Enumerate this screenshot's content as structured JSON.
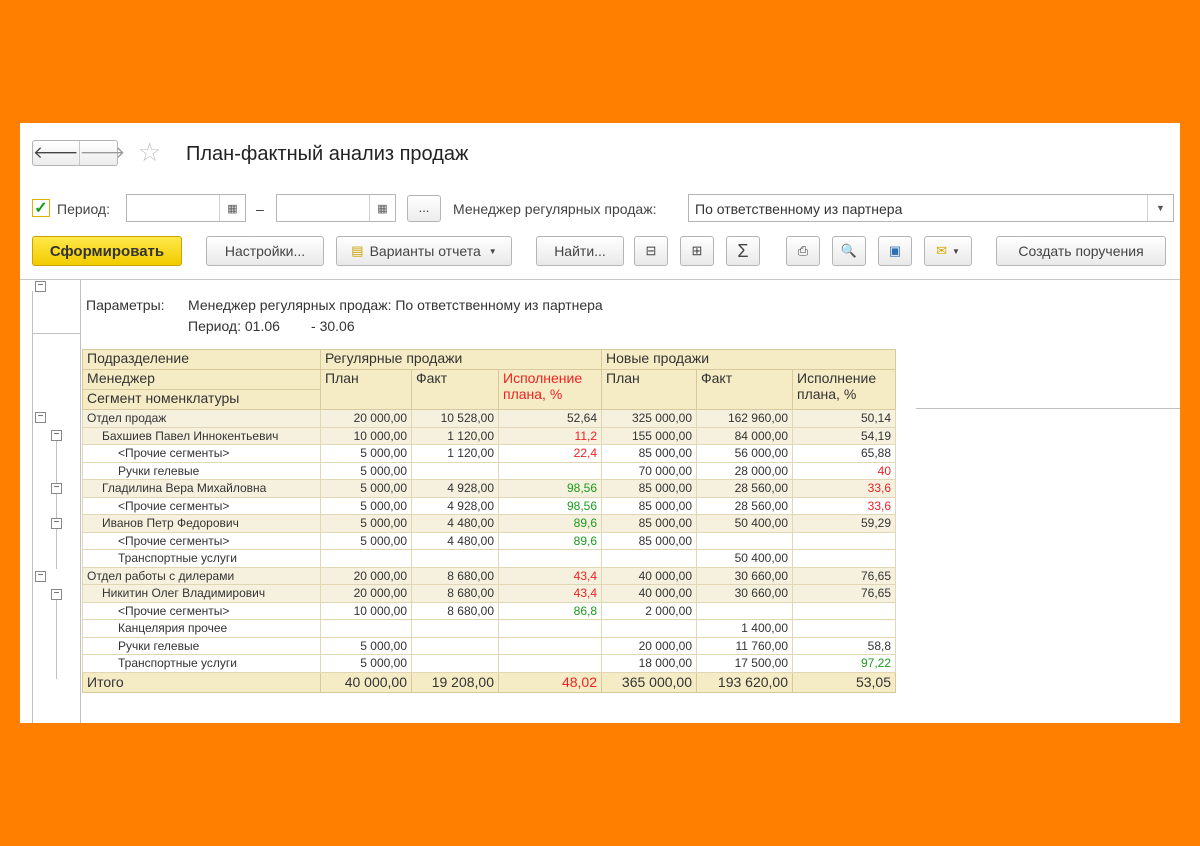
{
  "header": {
    "title": "План-фактный анализ продаж",
    "back": "🡐",
    "forward": "🡒",
    "star": "☆"
  },
  "filters": {
    "period_label": "Период:",
    "dash": "–",
    "dots": "...",
    "manager_label": "Менеджер регулярных продаж:",
    "manager_value": "По ответственному из партнера"
  },
  "toolbar": {
    "generate": "Сформировать",
    "settings": "Настройки...",
    "variants": "Варианты отчета",
    "find": "Найти...",
    "create_order": "Создать поручения"
  },
  "params": {
    "label": "Параметры:",
    "line1": "Менеджер регулярных продаж: По ответственному из партнера",
    "line2": "Период: 01.06        - 30.06"
  },
  "table": {
    "h_dept": "Подразделение",
    "h_manager": "Менеджер",
    "h_segment": "Сегмент номенклатуры",
    "h_regular": "Регулярные продажи",
    "h_new": "Новые продажи",
    "h_plan": "План",
    "h_fact": "Факт",
    "h_exec_1": "Исполнение",
    "h_exec_2": "плана, %",
    "rows": [
      {
        "name": "Отдел продаж",
        "p1": "20 000,00",
        "f1": "10 528,00",
        "e1": "52,64",
        "p2": "325 000,00",
        "f2": "162 960,00",
        "e2": "50,14"
      },
      {
        "name": "Бахшиев Павел Иннокентьевич",
        "p1": "10 000,00",
        "f1": "1 120,00",
        "e1": "11,2",
        "p2": "155 000,00",
        "f2": "84 000,00",
        "e2": "54,19"
      },
      {
        "name": "<Прочие сегменты>",
        "p1": "5 000,00",
        "f1": "1 120,00",
        "e1": "22,4",
        "p2": "85 000,00",
        "f2": "56 000,00",
        "e2": "65,88"
      },
      {
        "name": "Ручки гелевые",
        "p1": "5 000,00",
        "f1": "",
        "e1": "",
        "p2": "70 000,00",
        "f2": "28 000,00",
        "e2": "40"
      },
      {
        "name": "Гладилина Вера Михайловна",
        "p1": "5 000,00",
        "f1": "4 928,00",
        "e1": "98,56",
        "p2": "85 000,00",
        "f2": "28 560,00",
        "e2": "33,6"
      },
      {
        "name": "<Прочие сегменты>",
        "p1": "5 000,00",
        "f1": "4 928,00",
        "e1": "98,56",
        "p2": "85 000,00",
        "f2": "28 560,00",
        "e2": "33,6"
      },
      {
        "name": "Иванов Петр Федорович",
        "p1": "5 000,00",
        "f1": "4 480,00",
        "e1": "89,6",
        "p2": "85 000,00",
        "f2": "50 400,00",
        "e2": "59,29"
      },
      {
        "name": "<Прочие сегменты>",
        "p1": "5 000,00",
        "f1": "4 480,00",
        "e1": "89,6",
        "p2": "85 000,00",
        "f2": "",
        "e2": ""
      },
      {
        "name": "Транспортные услуги",
        "p1": "",
        "f1": "",
        "e1": "",
        "p2": "",
        "f2": "50 400,00",
        "e2": ""
      },
      {
        "name": "Отдел работы с дилерами",
        "p1": "20 000,00",
        "f1": "8 680,00",
        "e1": "43,4",
        "p2": "40 000,00",
        "f2": "30 660,00",
        "e2": "76,65"
      },
      {
        "name": "Никитин Олег Владимирович",
        "p1": "20 000,00",
        "f1": "8 680,00",
        "e1": "43,4",
        "p2": "40 000,00",
        "f2": "30 660,00",
        "e2": "76,65"
      },
      {
        "name": "<Прочие сегменты>",
        "p1": "10 000,00",
        "f1": "8 680,00",
        "e1": "86,8",
        "p2": "2 000,00",
        "f2": "",
        "e2": ""
      },
      {
        "name": "Канцелярия прочее",
        "p1": "",
        "f1": "",
        "e1": "",
        "p2": "",
        "f2": "1 400,00",
        "e2": ""
      },
      {
        "name": "Ручки гелевые",
        "p1": "5 000,00",
        "f1": "",
        "e1": "",
        "p2": "20 000,00",
        "f2": "11 760,00",
        "e2": "58,8"
      },
      {
        "name": "Транспортные услуги",
        "p1": "5 000,00",
        "f1": "",
        "e1": "",
        "p2": "18 000,00",
        "f2": "17 500,00",
        "e2": "97,22"
      }
    ],
    "total": {
      "name": "Итого",
      "p1": "40 000,00",
      "f1": "19 208,00",
      "e1": "48,02",
      "p2": "365 000,00",
      "f2": "193 620,00",
      "e2": "53,05"
    }
  }
}
